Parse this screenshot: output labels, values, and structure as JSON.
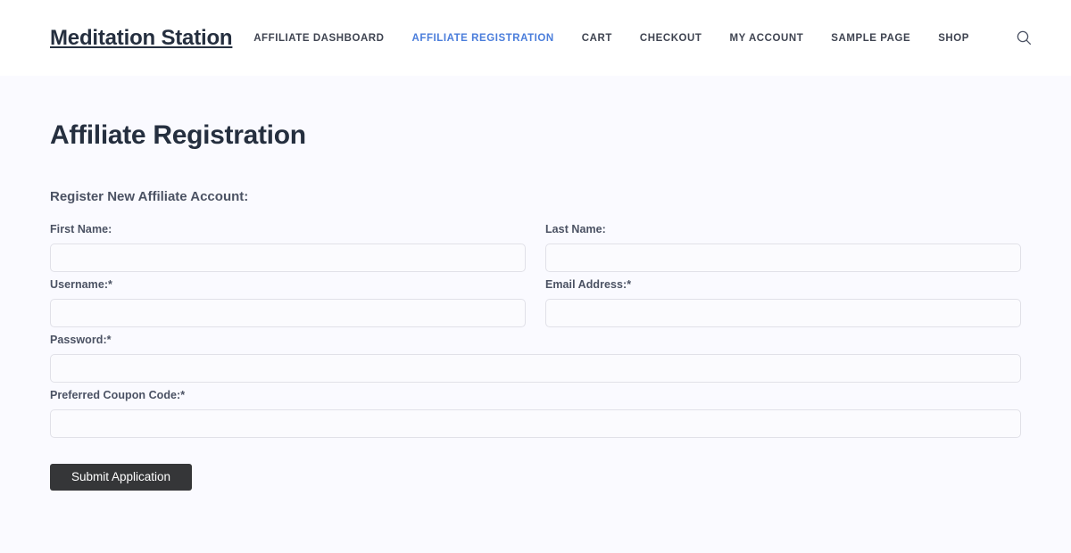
{
  "header": {
    "brand": "Meditation Station",
    "nav": [
      {
        "label": "AFFILIATE DASHBOARD",
        "active": false
      },
      {
        "label": "AFFILIATE REGISTRATION",
        "active": true
      },
      {
        "label": "CART",
        "active": false
      },
      {
        "label": "CHECKOUT",
        "active": false
      },
      {
        "label": "MY ACCOUNT",
        "active": false
      },
      {
        "label": "SAMPLE PAGE",
        "active": false
      },
      {
        "label": "SHOP",
        "active": false
      }
    ],
    "search_icon": "search-icon"
  },
  "main": {
    "page_title": "Affiliate Registration",
    "section_title": "Register New Affiliate Account:",
    "fields": [
      {
        "label": "First Name:",
        "value": "",
        "placeholder": "",
        "name": "first-name"
      },
      {
        "label": "Last Name:",
        "value": "",
        "placeholder": "",
        "name": "last-name"
      },
      {
        "label": "Username:*",
        "value": "",
        "placeholder": "",
        "name": "username"
      },
      {
        "label": "Email Address:*",
        "value": "",
        "placeholder": "",
        "name": "email-address"
      },
      {
        "label": "Password:*",
        "value": "",
        "placeholder": "",
        "name": "password"
      },
      {
        "label": "Preferred Coupon Code:*",
        "value": "",
        "placeholder": "",
        "name": "preferred-coupon-code"
      }
    ],
    "submit_label": "Submit Application"
  },
  "colors": {
    "page_background": "#fafaff",
    "header_background": "#ffffff",
    "heading_text": "#252f3f",
    "nav_text": "#3f4451",
    "nav_active": "#4a7ddb",
    "label_text": "#4b5263",
    "input_border": "#e1e1e8",
    "input_background": "#fbfbfe",
    "button_background": "#353638",
    "button_text": "#ffffff"
  }
}
